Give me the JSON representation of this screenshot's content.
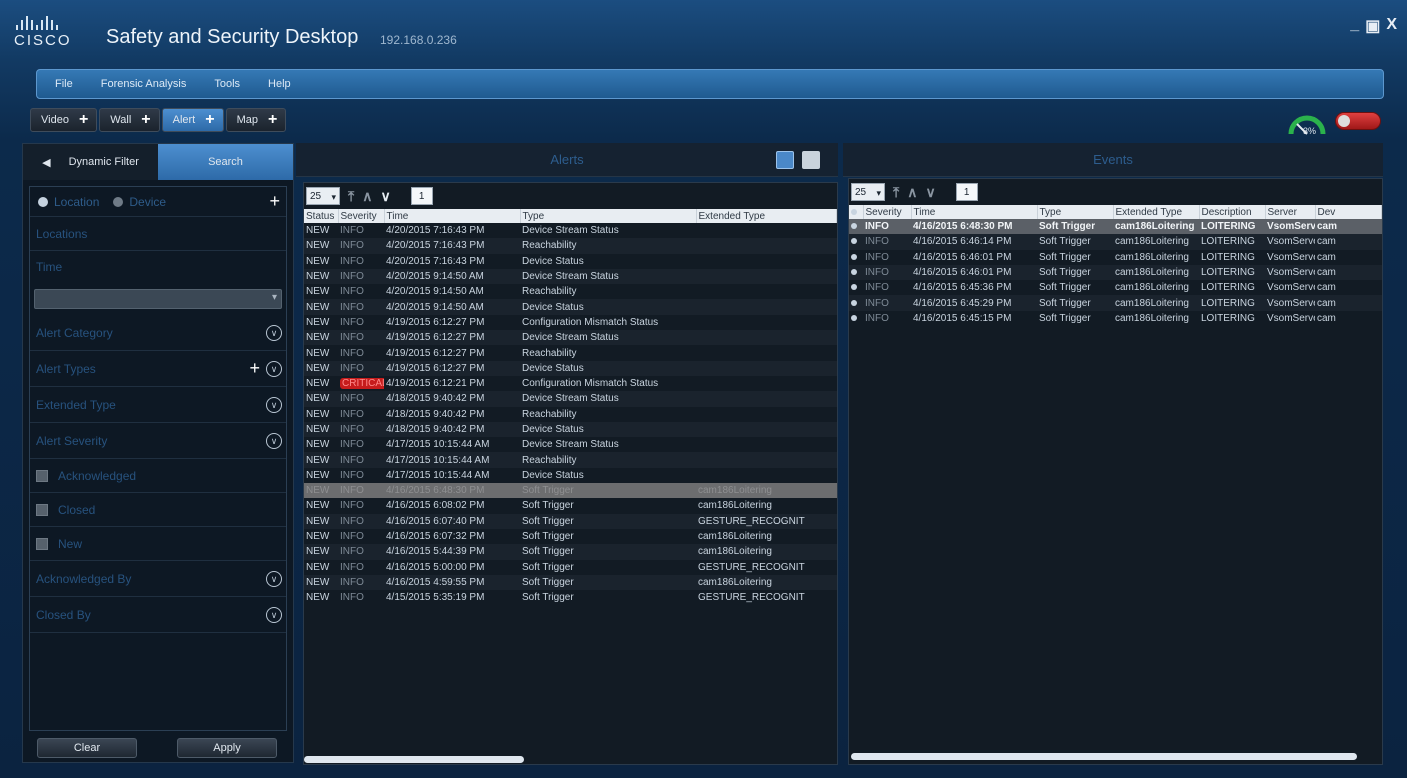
{
  "app": {
    "logo_text": "CISCO",
    "title": "Safety and Security Desktop",
    "ip": "192.168.0.236",
    "controls": [
      "_",
      "▣",
      "X"
    ]
  },
  "menu": [
    "File",
    "Forensic Analysis",
    "Tools",
    "Help"
  ],
  "workspace_tabs": [
    {
      "label": "Video",
      "active": false
    },
    {
      "label": "Wall",
      "active": false
    },
    {
      "label": "Alert",
      "active": true
    },
    {
      "label": "Map",
      "active": false
    }
  ],
  "status": {
    "cpu_label": "3%"
  },
  "left_panel": {
    "tabs": {
      "dynamic_filter": "Dynamic Filter",
      "search": "Search"
    },
    "radio": {
      "location": "Location",
      "device": "Device"
    },
    "locations": "Locations",
    "time": "Time",
    "alert_category": "Alert Category",
    "alert_types": "Alert Types",
    "extended_type": "Extended Type",
    "alert_severity": "Alert Severity",
    "checks": [
      "Acknowledged",
      "Closed",
      "New"
    ],
    "acknowledged_by": "Acknowledged By",
    "closed_by": "Closed By",
    "buttons": {
      "clear": "Clear",
      "apply": "Apply"
    }
  },
  "alerts": {
    "title": "Alerts",
    "page_size": "25",
    "page": "1",
    "columns": [
      "Status",
      "Severity",
      "Time",
      "Type",
      "Extended Type"
    ],
    "rows": [
      [
        "NEW",
        "INFO",
        "4/20/2015 7:16:43 PM",
        "Device Stream Status",
        ""
      ],
      [
        "NEW",
        "INFO",
        "4/20/2015 7:16:43 PM",
        "Reachability",
        ""
      ],
      [
        "NEW",
        "INFO",
        "4/20/2015 7:16:43 PM",
        "Device Status",
        ""
      ],
      [
        "NEW",
        "INFO",
        "4/20/2015 9:14:50 AM",
        "Device Stream Status",
        ""
      ],
      [
        "NEW",
        "INFO",
        "4/20/2015 9:14:50 AM",
        "Reachability",
        ""
      ],
      [
        "NEW",
        "INFO",
        "4/20/2015 9:14:50 AM",
        "Device Status",
        ""
      ],
      [
        "NEW",
        "INFO",
        "4/19/2015 6:12:27 PM",
        "Configuration Mismatch Status",
        ""
      ],
      [
        "NEW",
        "INFO",
        "4/19/2015 6:12:27 PM",
        "Device Stream Status",
        ""
      ],
      [
        "NEW",
        "INFO",
        "4/19/2015 6:12:27 PM",
        "Reachability",
        ""
      ],
      [
        "NEW",
        "INFO",
        "4/19/2015 6:12:27 PM",
        "Device Status",
        ""
      ],
      [
        "NEW",
        "CRITICAL",
        "4/19/2015 6:12:21 PM",
        "Configuration Mismatch Status",
        ""
      ],
      [
        "NEW",
        "INFO",
        "4/18/2015 9:40:42 PM",
        "Device Stream Status",
        ""
      ],
      [
        "NEW",
        "INFO",
        "4/18/2015 9:40:42 PM",
        "Reachability",
        ""
      ],
      [
        "NEW",
        "INFO",
        "4/18/2015 9:40:42 PM",
        "Device Status",
        ""
      ],
      [
        "NEW",
        "INFO",
        "4/17/2015 10:15:44 AM",
        "Device Stream Status",
        ""
      ],
      [
        "NEW",
        "INFO",
        "4/17/2015 10:15:44 AM",
        "Reachability",
        ""
      ],
      [
        "NEW",
        "INFO",
        "4/17/2015 10:15:44 AM",
        "Device Status",
        ""
      ],
      [
        "NEW",
        "INFO",
        "4/16/2015 6:48:30 PM",
        "Soft Trigger",
        "cam186Loitering"
      ],
      [
        "NEW",
        "INFO",
        "4/16/2015 6:08:02 PM",
        "Soft Trigger",
        "cam186Loitering"
      ],
      [
        "NEW",
        "INFO",
        "4/16/2015 6:07:40 PM",
        "Soft Trigger",
        "GESTURE_RECOGNIT"
      ],
      [
        "NEW",
        "INFO",
        "4/16/2015 6:07:32 PM",
        "Soft Trigger",
        "cam186Loitering"
      ],
      [
        "NEW",
        "INFO",
        "4/16/2015 5:44:39 PM",
        "Soft Trigger",
        "cam186Loitering"
      ],
      [
        "NEW",
        "INFO",
        "4/16/2015 5:00:00 PM",
        "Soft Trigger",
        "GESTURE_RECOGNIT"
      ],
      [
        "NEW",
        "INFO",
        "4/16/2015 4:59:55 PM",
        "Soft Trigger",
        "cam186Loitering"
      ],
      [
        "NEW",
        "INFO",
        "4/15/2015 5:35:19 PM",
        "Soft Trigger",
        "GESTURE_RECOGNIT"
      ]
    ],
    "selected_row": 17
  },
  "events": {
    "title": "Events",
    "page_size": "25",
    "page": "1",
    "columns": [
      "",
      "Severity",
      "Time",
      "Type",
      "Extended Type",
      "Description",
      "Server",
      "Dev"
    ],
    "rows": [
      [
        "INFO",
        "4/16/2015 6:48:30 PM",
        "Soft Trigger",
        "cam186Loitering",
        "LOITERING",
        "VsomServer",
        "cam"
      ],
      [
        "INFO",
        "4/16/2015 6:46:14 PM",
        "Soft Trigger",
        "cam186Loitering",
        "LOITERING",
        "VsomServer",
        "cam"
      ],
      [
        "INFO",
        "4/16/2015 6:46:01 PM",
        "Soft Trigger",
        "cam186Loitering",
        "LOITERING",
        "VsomServer",
        "cam"
      ],
      [
        "INFO",
        "4/16/2015 6:46:01 PM",
        "Soft Trigger",
        "cam186Loitering",
        "LOITERING",
        "VsomServer",
        "cam"
      ],
      [
        "INFO",
        "4/16/2015 6:45:36 PM",
        "Soft Trigger",
        "cam186Loitering",
        "LOITERING",
        "VsomServer",
        "cam"
      ],
      [
        "INFO",
        "4/16/2015 6:45:29 PM",
        "Soft Trigger",
        "cam186Loitering",
        "LOITERING",
        "VsomServer",
        "cam"
      ],
      [
        "INFO",
        "4/16/2015 6:45:15 PM",
        "Soft Trigger",
        "cam186Loitering",
        "LOITERING",
        "VsomServer",
        "cam"
      ]
    ],
    "selected_row": 0
  },
  "colors": {
    "accent": "#3d7fc0",
    "critical": "#c61c1c"
  }
}
